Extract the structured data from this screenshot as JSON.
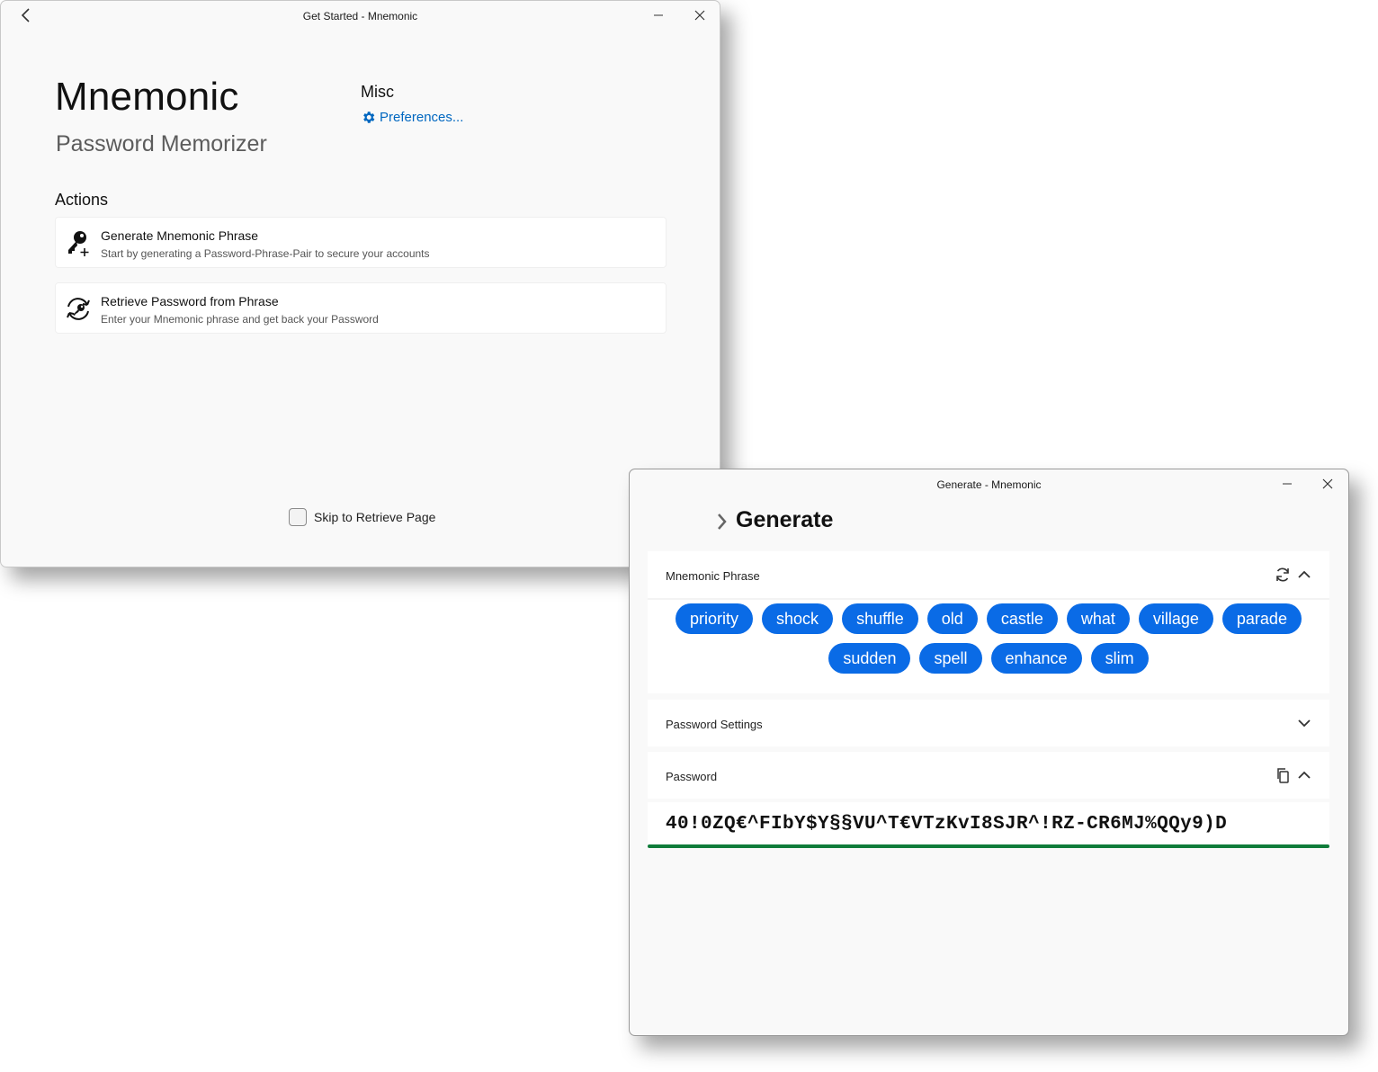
{
  "window1": {
    "title": "Get Started - Mnemonic",
    "app_name": "Mnemonic",
    "app_subtitle": "Password Memorizer",
    "misc": {
      "heading": "Misc",
      "preferences_label": "Preferences..."
    },
    "actions": {
      "heading": "Actions",
      "items": [
        {
          "title": "Generate Mnemonic Phrase",
          "subtitle": "Start by generating a Password-Phrase-Pair to secure your accounts",
          "icon": "key-add-icon"
        },
        {
          "title": "Retrieve Password from Phrase",
          "subtitle": "Enter your Mnemonic phrase and get back your Password",
          "icon": "key-retrieve-icon"
        }
      ]
    },
    "skip_label": "Skip to Retrieve Page",
    "skip_checked": false
  },
  "window2": {
    "title": "Generate - Mnemonic",
    "page_title": "Generate",
    "phrase_section": {
      "label": "Mnemonic Phrase",
      "words": [
        "priority",
        "shock",
        "shuffle",
        "old",
        "castle",
        "what",
        "village",
        "parade",
        "sudden",
        "spell",
        "enhance",
        "slim"
      ]
    },
    "settings_section": {
      "label": "Password Settings"
    },
    "password_section": {
      "label": "Password",
      "value": "40!0ZQ€^FIbY$Y§§VU^T€VTzKvI8SJR^!RZ-CR6MJ%QQy9)D"
    }
  },
  "colors": {
    "accent": "#0067c0",
    "chip": "#0a6be6",
    "strength_bar": "#107c3a"
  }
}
